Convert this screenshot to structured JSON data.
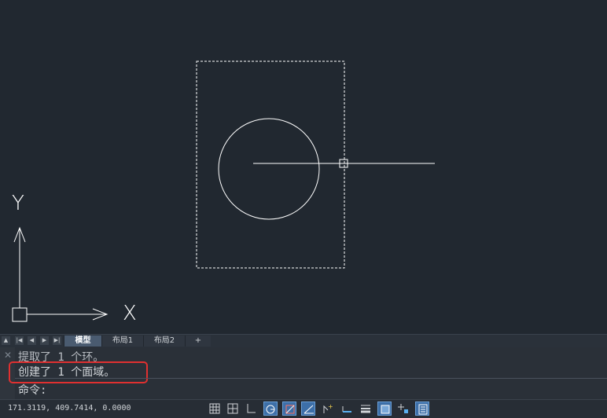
{
  "layout_tabs": {
    "model": "模型",
    "layout1": "布局1",
    "layout2": "布局2",
    "add": "+"
  },
  "command_history": {
    "line1": "提取了 1 个环。",
    "line2": "创建了 1 个面域。",
    "prompt": "命令:"
  },
  "status": {
    "coordinates": "171.3119, 409.7414, 0.0000"
  },
  "ucs": {
    "x_label": "X",
    "y_label": "Y"
  },
  "icons": [
    "grid-icon",
    "snap-icon",
    "ortho-icon",
    "polar-icon",
    "osnap-icon",
    "otrack-icon",
    "dynamic-input-icon",
    "lineweight-icon",
    "lineweight-display-icon",
    "transparency-icon",
    "selection-cycling-icon",
    "quick-properties-icon"
  ],
  "colors": {
    "background": "#212830",
    "highlight_box": "#e03030",
    "active_toggle": "#3d6fa8"
  }
}
